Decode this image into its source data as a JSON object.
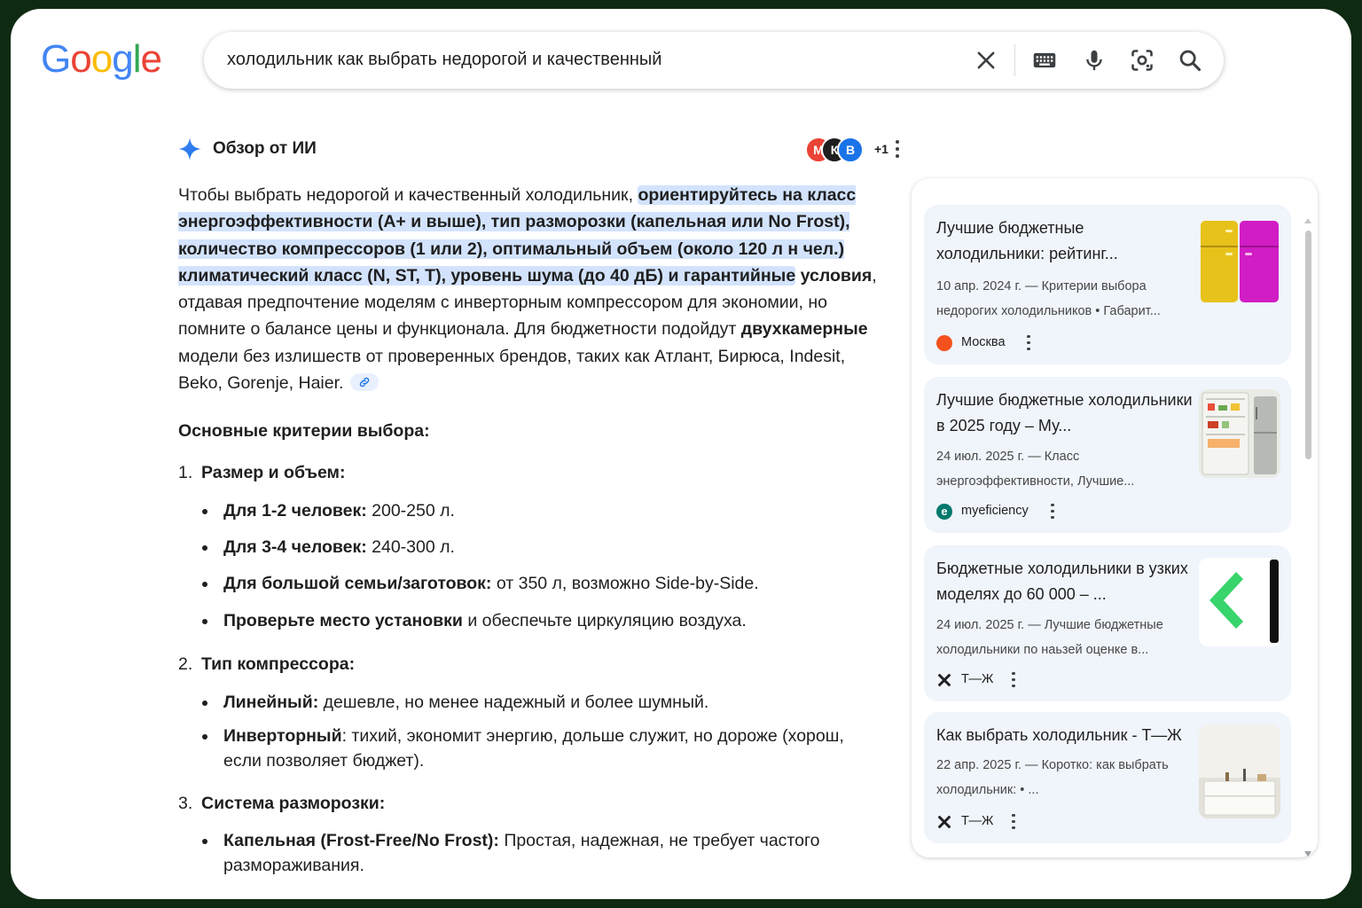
{
  "logo": {
    "letters": [
      "G",
      "o",
      "o",
      "g",
      "l",
      "e"
    ],
    "colors": [
      "#4285F4",
      "#EA4335",
      "#FBBC05",
      "#4285F4",
      "#34A853",
      "#EA4335"
    ]
  },
  "search": {
    "query": "холодильник как выбрать недорогой и качественный",
    "icons": [
      "close-icon",
      "keyboard-icon",
      "mic-icon",
      "lens-icon",
      "search-icon"
    ]
  },
  "ai_overview": {
    "title": "Обзор от ИИ",
    "sources_more": "+1",
    "avatars": [
      {
        "letter": "М",
        "color": "#EA4335"
      },
      {
        "letter": "К",
        "color": "#1f1f1f"
      },
      {
        "letter": "В",
        "color": "#1a73e8"
      }
    ],
    "summary": {
      "p1": "Чтобы выбрать недорогой и качественный холодильник, ",
      "highlight": "ориентируйтесь на класс энергоэффективности (A+ и выше), тип разморозки (капельная или No Frost), количество компрессоров (1 или 2), оптимальный объем (около 120 л н чел.) климатический класс (N, ST, T), уровень шума (до 40 дБ) и гарантийные",
      "bold_tail": "условия",
      "p2": ", отдавая предпочтение моделям с инверторным компрессором для экономии, но помните о балансе цены и функционала. Для бюджетности подойдут ",
      "bold2": "двухкамерные",
      "p3": " модели без излишеств от проверенных брендов, таких как Атлант, Бирюса, Indesit, Beko, Gorenje, Haier."
    },
    "criteria_title": "Основные критерии выбора:",
    "sections": [
      {
        "num": "1.",
        "title": "Размер и объем:",
        "bullets": [
          {
            "bold": "Для 1-2 человек:",
            "text": " 200-250 л."
          },
          {
            "bold": "Для 3-4 человек:",
            "text": " 240-300 л."
          },
          {
            "bold": "Для большой семьи/заготовок:",
            "text": " от 350 л, возможно Side-by-Side."
          },
          {
            "bold": "Проверьте место установки",
            "text": " и обеспечьте циркуляцию воздуха."
          }
        ]
      },
      {
        "num": "2.",
        "title": "Тип компрессора:",
        "bullets": [
          {
            "bold": "Линейный:",
            "text": " дешевле, но менее надежный и более шумный."
          },
          {
            "bold": "Инверторный",
            "text": ": тихий, экономит энергию, дольше служит, но дороже (хорош, если позволяет бюджет)."
          }
        ]
      },
      {
        "num": "3.",
        "title": "Система разморозки:",
        "bullets": [
          {
            "bold": "Капельная (Frost-Free/No Frost):",
            "text": " Простая, надежная, не требует частого размораживания."
          }
        ]
      }
    ]
  },
  "panel": {
    "cards": [
      {
        "title": "Лучшие бюджетные холодильники: рейтинг...",
        "snippet": "10 апр. 2024 г. — Критерии выбора недорогих холодильников • Габарит...",
        "source": "Москва",
        "fav_color": "#f4511e"
      },
      {
        "title": "Лучшие бюджетные холодильники в 2025 году – Му...",
        "snippet": "24 июл. 2025 г. — Класс энергоэффективности, Лучшие...",
        "source": "myeficiency",
        "fav_color": "#00796b",
        "fav_letter": "e"
      },
      {
        "title": "Бюджетные холодильники в узких моделях до 60 000 – ...",
        "snippet": "24 июл. 2025 г. — Лучшие бюджетные холодильники по наьзей оценке в...",
        "source": "Т—Ж",
        "fav_color": "#1f1f1f"
      },
      {
        "title": "Как выбрать холодильник - Т—Ж",
        "snippet": "22 апр. 2025 г. — Коротко: как выбрать холодильник: • ...",
        "source": "Т—Ж",
        "fav_color": "#1f1f1f"
      }
    ]
  }
}
